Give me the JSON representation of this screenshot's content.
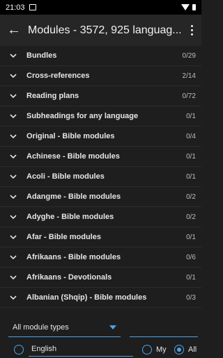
{
  "status_bar": {
    "time": "21:03",
    "notification_icon": "notification-icon",
    "wifi_icon": "wifi-icon",
    "battery_icon": "battery-icon"
  },
  "app_bar": {
    "title": "Modules - 3572, 925 languag...",
    "back_icon": "arrow-back-icon",
    "more_icon": "more-vert-icon"
  },
  "modules": [
    {
      "label": "Bundles",
      "count": "0/29"
    },
    {
      "label": "Cross-references",
      "count": "2/14"
    },
    {
      "label": "Reading plans",
      "count": "0/72"
    },
    {
      "label": "Subheadings for any language",
      "count": "0/1"
    },
    {
      "label": "Original - Bible modules",
      "count": "0/4"
    },
    {
      "label": "Achinese - Bible modules",
      "count": "0/1"
    },
    {
      "label": "Acoli - Bible modules",
      "count": "0/1"
    },
    {
      "label": "Adangme - Bible modules",
      "count": "0/2"
    },
    {
      "label": "Adyghe - Bible modules",
      "count": "0/2"
    },
    {
      "label": "Afar - Bible modules",
      "count": "0/1"
    },
    {
      "label": "Afrikaans - Bible modules",
      "count": "0/6"
    },
    {
      "label": "Afrikaans - Devotionals",
      "count": "0/1"
    },
    {
      "label": "Albanian (Shqip) - Bible modules",
      "count": "0/3"
    }
  ],
  "filters": {
    "module_type": "All module types",
    "language": "English",
    "language_selected": false,
    "scope_my": "My",
    "scope_all": "All",
    "scope_selected": "All"
  },
  "colors": {
    "accent": "#4da3e8",
    "background": "#1e1e1e",
    "app_bar": "#262626"
  }
}
